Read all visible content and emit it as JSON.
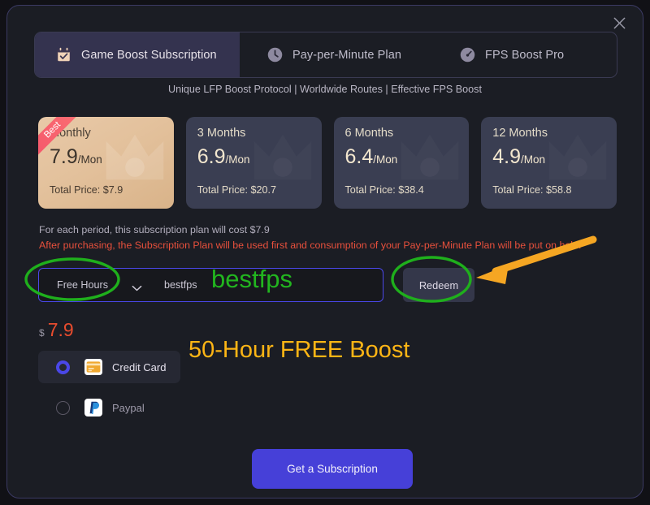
{
  "window": {
    "close_icon": "close-icon",
    "accent": "#4a47e8",
    "background": "#1b1d24"
  },
  "tabs": [
    {
      "label": "Game Boost Subscription",
      "icon": "calendar-check-icon",
      "active": true
    },
    {
      "label": "Pay-per-Minute Plan",
      "icon": "clock-icon",
      "active": false
    },
    {
      "label": "FPS Boost Pro",
      "icon": "speedometer-icon",
      "active": false
    }
  ],
  "subtitle": "Unique LFP Boost Protocol | Worldwide Routes | Effective FPS Boost",
  "plans": [
    {
      "name": "Monthly",
      "price": "7.9",
      "per": "/Mon",
      "total": "Total Price: $7.9",
      "badge": "Best",
      "selected": true
    },
    {
      "name": "3 Months",
      "price": "6.9",
      "per": "/Mon",
      "total": "Total Price: $20.7",
      "badge": "",
      "selected": false
    },
    {
      "name": "6 Months",
      "price": "6.4",
      "per": "/Mon",
      "total": "Total Price: $38.4",
      "badge": "",
      "selected": false
    },
    {
      "name": "12 Months",
      "price": "4.9",
      "per": "/Mon",
      "total": "Total Price: $58.8",
      "badge": "",
      "selected": false
    }
  ],
  "notes": {
    "period_cost": "For each period, this subscription plan will cost $7.9",
    "warning": "After purchasing, the Subscription Plan will be used first and consumption of your Pay-per-Minute Plan will be put on hold.",
    "warning_color": "#e8503c"
  },
  "coupon": {
    "type_label": "Free Hours",
    "chevron_icon": "chevron-down-icon",
    "code_value": "bestfps",
    "code_placeholder": "bestfps",
    "redeem_label": "Redeem",
    "border_color": "#4a47e8"
  },
  "price": {
    "currency": "$",
    "amount": "7.9",
    "color": "#e84c2e"
  },
  "payment_methods": [
    {
      "label": "Credit Card",
      "icon": "credit-card-icon",
      "selected": true
    },
    {
      "label": "Paypal",
      "icon": "paypal-icon",
      "selected": false
    }
  ],
  "cta": {
    "label": "Get a Subscription",
    "color": "#4640d8"
  },
  "annotations": {
    "coupon_code_overlay": "bestfps",
    "coupon_code_overlay_color": "#22b61f",
    "promo_overlay": "50-Hour FREE Boost",
    "promo_overlay_color": "#fdb515",
    "ellipse_color": "#1faf1c",
    "arrow_color": "#f5a623",
    "ellipse_targets": [
      "Free Hours",
      "Redeem"
    ],
    "arrow_target": "Redeem"
  }
}
